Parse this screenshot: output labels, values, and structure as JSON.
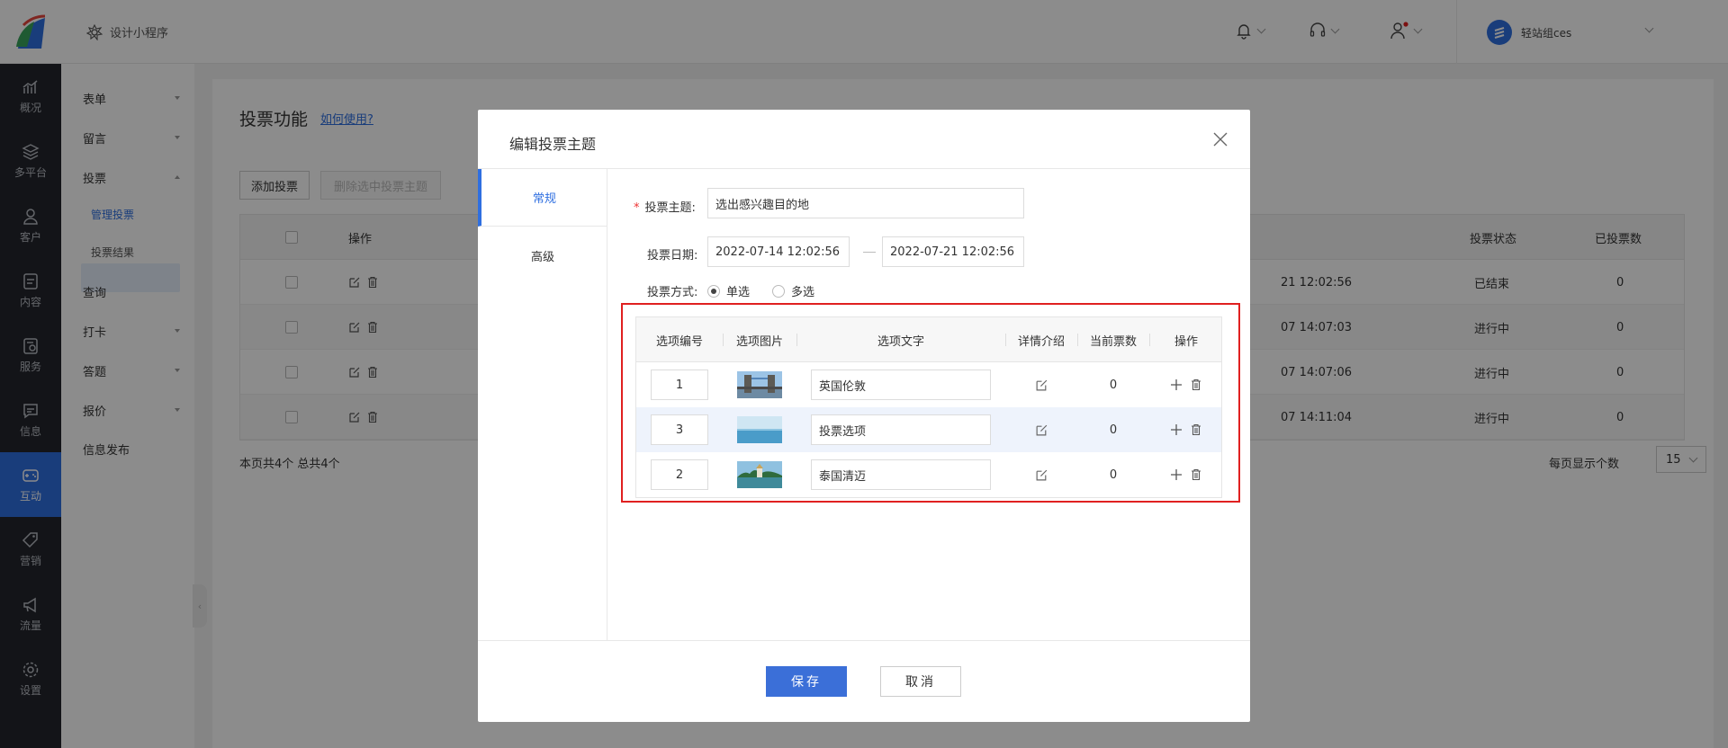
{
  "header": {
    "app_switch_label": "设计小程序",
    "user_name": "轻站组ces"
  },
  "sidebar": {
    "items": [
      {
        "label": "概况",
        "icon": "chart-bars-icon"
      },
      {
        "label": "多平台",
        "icon": "layers-icon"
      },
      {
        "label": "客户",
        "icon": "person-icon"
      },
      {
        "label": "内容",
        "icon": "document-icon"
      },
      {
        "label": "服务",
        "icon": "service-icon"
      },
      {
        "label": "信息",
        "icon": "message-icon"
      },
      {
        "label": "互动",
        "icon": "gamepad-icon",
        "active": true
      },
      {
        "label": "营销",
        "icon": "tag-icon"
      },
      {
        "label": "流量",
        "icon": "megaphone-icon"
      },
      {
        "label": "设置",
        "icon": "gear-icon"
      }
    ]
  },
  "subnav": {
    "items": [
      "表单",
      "留言",
      "投票",
      "查询",
      "打卡",
      "答题",
      "报价",
      "信息发布"
    ],
    "sub_items": [
      "管理投票",
      "投票结果"
    ],
    "collapse_glyph": "‹"
  },
  "main": {
    "title": "投票功能",
    "howto": "如何使用?",
    "add_button": "添加投票",
    "delete_button": "删除选中投票主题",
    "columns": [
      "操作",
      "投票状态",
      "已投票数"
    ],
    "rows": [
      {
        "time": "21 12:02:56",
        "status": "已结束",
        "count": "0"
      },
      {
        "time": "07 14:07:03",
        "status": "进行中",
        "count": "0"
      },
      {
        "time": "07 14:07:06",
        "status": "进行中",
        "count": "0"
      },
      {
        "time": "07 14:11:04",
        "status": "进行中",
        "count": "0"
      }
    ],
    "pager_left": "本页共4个 总共4个",
    "pager_right": "每页显示个数",
    "page_size": "15"
  },
  "modal": {
    "title": "编辑投票主题",
    "tabs": [
      "常规",
      "高级"
    ],
    "form": {
      "topic_label": "投票主题:",
      "topic_value": "选出感兴趣目的地",
      "date_label": "投票日期:",
      "start_date": "2022-07-14 12:02:56",
      "end_date": "2022-07-21 12:02:56",
      "mode_label": "投票方式:",
      "mode_single": "单选",
      "mode_multi": "多选"
    },
    "options_table": {
      "headers": [
        "选项编号",
        "选项图片",
        "选项文字",
        "详情介绍",
        "当前票数",
        "操作"
      ],
      "rows": [
        {
          "num": "1",
          "text": "英国伦敦",
          "votes": "0"
        },
        {
          "num": "3",
          "text": "投票选项",
          "votes": "0"
        },
        {
          "num": "2",
          "text": "泰国清迈",
          "votes": "0"
        }
      ]
    },
    "save": "保存",
    "cancel": "取消"
  },
  "colors": {
    "accent": "#2f6fe0",
    "sidebar_bg": "#23262d",
    "highlight_frame": "#e02020"
  }
}
